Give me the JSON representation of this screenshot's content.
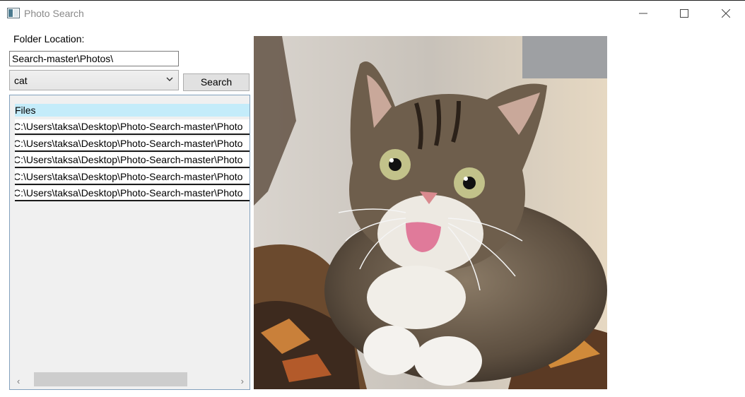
{
  "window": {
    "title": "Photo Search",
    "icon": "app-window-icon",
    "controls": [
      "minimize-icon",
      "maximize-icon",
      "close-icon"
    ]
  },
  "form": {
    "folder_label": "Folder Location:",
    "folder_value": "Search-master\\Photos\\",
    "query_value": "cat",
    "search_label": "Search"
  },
  "results": {
    "header": "Files",
    "items": [
      "C:\\Users\\taksa\\Desktop\\Photo-Search-master\\Photo",
      "C:\\Users\\taksa\\Desktop\\Photo-Search-master\\Photo",
      "C:\\Users\\taksa\\Desktop\\Photo-Search-master\\Photo",
      "C:\\Users\\taksa\\Desktop\\Photo-Search-master\\Photo",
      "C:\\Users\\taksa\\Desktop\\Photo-Search-master\\Photo"
    ]
  },
  "preview": {
    "image": "cat-photo"
  },
  "colors": {
    "list_header_bg": "#c4ecfa",
    "list_border": "#82a0bd",
    "button_bg": "#e1e1e1"
  }
}
